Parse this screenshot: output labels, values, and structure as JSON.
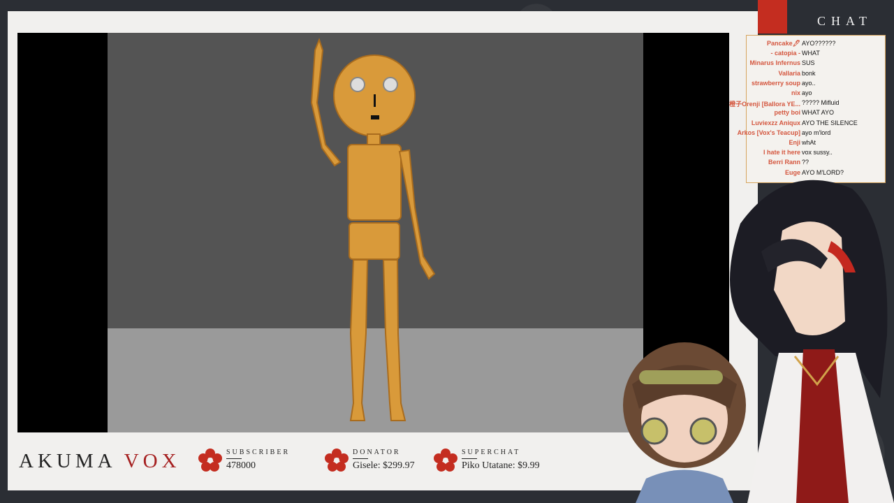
{
  "stream": {
    "brand_left": "AKUMA ",
    "brand_right": "VOX",
    "stats": [
      {
        "label": "SUBSCRIBER",
        "value": "478000"
      },
      {
        "label": "DONATOR",
        "value": "Gisele: $299.97"
      },
      {
        "label": "SUPERCHAT",
        "value": "Piko Utatane: $9.99"
      }
    ]
  },
  "chat": {
    "title": "CHAT",
    "messages": [
      {
        "name": "Pancake🖊",
        "text": "AYO??????"
      },
      {
        "name": "- catopia -",
        "text": "WHAT"
      },
      {
        "name": "Minarus Infernus",
        "text": "SUS"
      },
      {
        "name": "Vallaria",
        "text": "bonk"
      },
      {
        "name": "strawberry soup",
        "text": "ayo.."
      },
      {
        "name": "nix",
        "text": "ayo"
      },
      {
        "name": "橙子Orenji [Ballora YE...",
        "text": "????? Mifluid"
      },
      {
        "name": "petty boi",
        "text": "WHAT AYO"
      },
      {
        "name": "Luviexzz Aniqux",
        "text": "AYO THE SILENCE"
      },
      {
        "name": "Arkos [Vox's Teacup]",
        "text": "ayo m'lord"
      },
      {
        "name": "Enji",
        "text": "whAt"
      },
      {
        "name": "I hate it here",
        "text": "vox sussy.."
      },
      {
        "name": "Berri Rann",
        "text": "??"
      },
      {
        "name": "Euge",
        "text": "AYO M'LORD?"
      }
    ]
  },
  "colors": {
    "accent": "#a51f1f",
    "chat_name": "#d4563e",
    "frame": "#f1f0ee"
  }
}
